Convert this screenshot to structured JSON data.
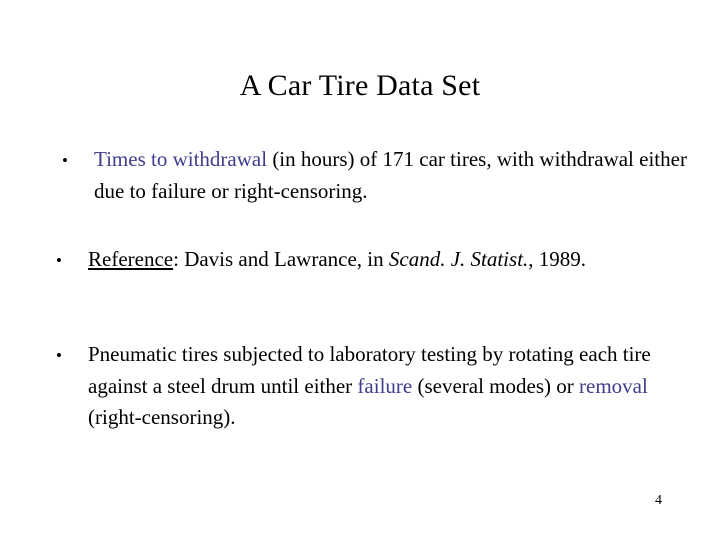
{
  "slide": {
    "title": "A Car Tire Data Set",
    "page_number": "4",
    "accent_color": "#3d3d8c",
    "background_color": "#ffffff",
    "text_color": "#000000",
    "bullet_glyph": "•",
    "bullets": [
      {
        "id": "times-to-withdrawal",
        "segments": {
          "accent_lead": "Times to withdrawal",
          "rest": " (in hours) of 171 car tires, with withdrawal either due to failure or right-censoring."
        }
      },
      {
        "id": "reference",
        "segments": {
          "label": "Reference",
          "after_label": ":  Davis and Lawrance, in ",
          "journal": "Scand. J. Statist.",
          "tail": ", 1989."
        }
      },
      {
        "id": "pneumatic-tires",
        "segments": {
          "part1": "Pneumatic tires subjected to laboratory testing by rotating each tire against a steel drum until either ",
          "accent1": "failure",
          "part2": " (several modes) or ",
          "accent2": "removal",
          "part3": " (right-censoring)."
        }
      }
    ]
  }
}
